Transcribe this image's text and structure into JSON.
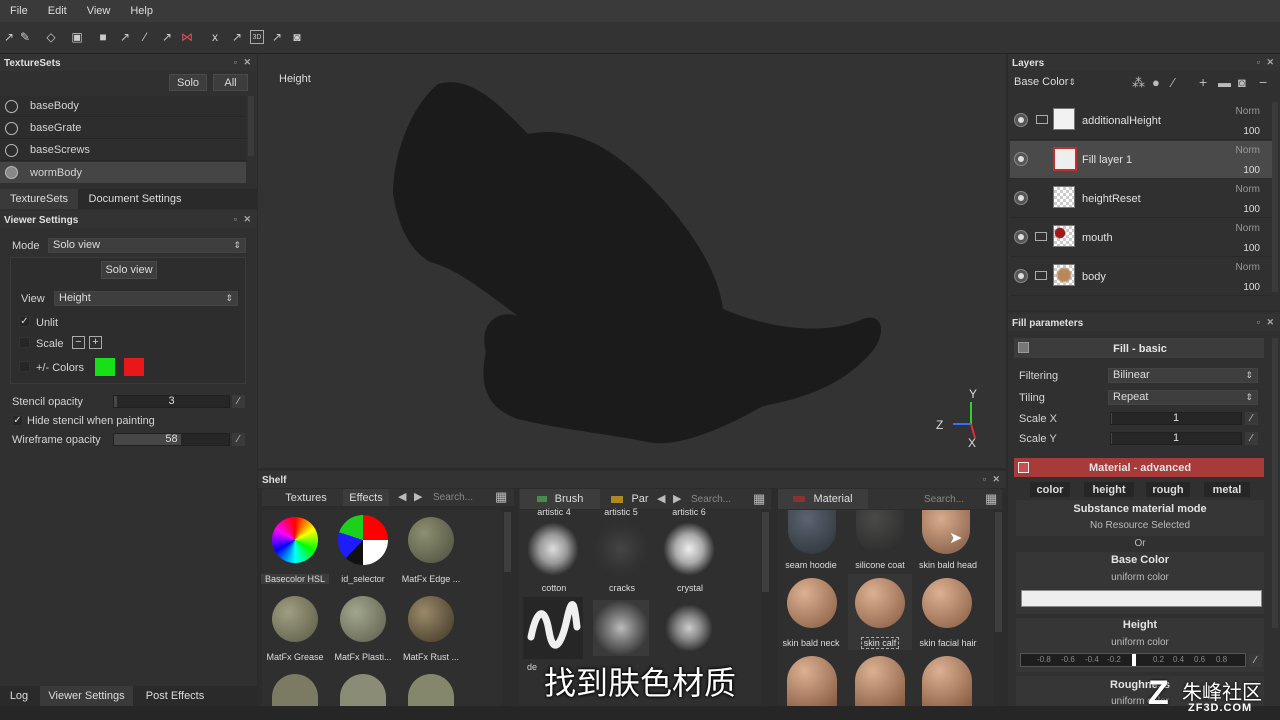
{
  "menu": {
    "file": "File",
    "edit": "Edit",
    "view": "View",
    "help": "Help"
  },
  "texturesets": {
    "title": "TextureSets",
    "solo": "Solo",
    "all": "All",
    "items": [
      "baseBody",
      "baseGrate",
      "baseScrews",
      "wormBody"
    ],
    "tab1": "TextureSets",
    "tab2": "Document Settings"
  },
  "viewer": {
    "title": "Viewer Settings",
    "mode_label": "Mode",
    "mode_value": "Solo view",
    "solo_button": "Solo view",
    "view_label": "View",
    "view_value": "Height",
    "unlit": "Unlit",
    "scale": "Scale",
    "colors": "+/- Colors",
    "color_plus": "#18e018",
    "color_minus": "#e81818",
    "stencil_opacity_label": "Stencil opacity",
    "stencil_opacity": "3",
    "hide_stencil": "Hide stencil when painting",
    "wireframe_label": "Wireframe opacity",
    "wireframe": "58"
  },
  "bottom_tabs": {
    "log": "Log",
    "viewer": "Viewer Settings",
    "post": "Post Effects"
  },
  "viewport": {
    "label": "Height",
    "axis_y": "Y",
    "axis_z": "Z",
    "axis_x": "X"
  },
  "shelf": {
    "title": "Shelf",
    "textures_tab": "Textures",
    "effects_tab": "Effects",
    "search": "Search...",
    "brush_tab": "Brush",
    "par_tab": "Par",
    "material_tab": "Material",
    "textures": [
      {
        "label": "Basecolor HSL"
      },
      {
        "label": "id_selector"
      },
      {
        "label": "MatFx Edge ..."
      },
      {
        "label": "MatFx Grease"
      },
      {
        "label": "MatFx Plasti..."
      },
      {
        "label": "MatFx Rust ..."
      }
    ],
    "brushes_top": [
      "artistic 4",
      "artistic 5",
      "artistic 6"
    ],
    "brushes": [
      {
        "label": "cotton"
      },
      {
        "label": "cracks"
      },
      {
        "label": "crystal"
      }
    ],
    "brush_partial": "de",
    "materials": [
      {
        "label": "seam hoodie"
      },
      {
        "label": "silicone coat"
      },
      {
        "label": "skin bald head"
      },
      {
        "label": "skin bald neck"
      },
      {
        "label": "skin calf"
      },
      {
        "label": "skin facial hair"
      }
    ]
  },
  "layers": {
    "title": "Layers",
    "channel": "Base Color",
    "items": [
      {
        "name": "additionalHeight",
        "blend": "Norm",
        "opacity": "100"
      },
      {
        "name": "Fill layer 1",
        "blend": "Norm",
        "opacity": "100"
      },
      {
        "name": "heightReset",
        "blend": "Norm",
        "opacity": "100"
      },
      {
        "name": "mouth",
        "blend": "Norm",
        "opacity": "100"
      },
      {
        "name": "body",
        "blend": "Norm",
        "opacity": "100"
      }
    ]
  },
  "fill": {
    "title": "Fill parameters",
    "basic": "Fill - basic",
    "filtering_label": "Filtering",
    "filtering": "Bilinear",
    "tiling_label": "Tiling",
    "tiling": "Repeat",
    "scalex_label": "Scale X",
    "scalex": "1",
    "scaley_label": "Scale Y",
    "scaley": "1",
    "advanced": "Material - advanced",
    "ch_color": "color",
    "ch_height": "height",
    "ch_rough": "rough",
    "ch_metal": "metal",
    "substance_mode": "Substance material mode",
    "no_resource": "No Resource Selected",
    "or": "Or",
    "base_color": "Base Color",
    "uniform1": "uniform color",
    "height": "Height",
    "uniform2": "uniform color",
    "height_ticks": [
      "-0.8",
      "-0.6",
      "-0.4",
      "-0.2",
      "0.2",
      "0.4",
      "0.6",
      "0.8"
    ],
    "height_value": 0,
    "roughness": "Roughness",
    "uniform3": "uniform color"
  },
  "subtitle": "找到肤色材质",
  "watermark": "朱峰社区",
  "watermark_url": "ZF3D.COM"
}
